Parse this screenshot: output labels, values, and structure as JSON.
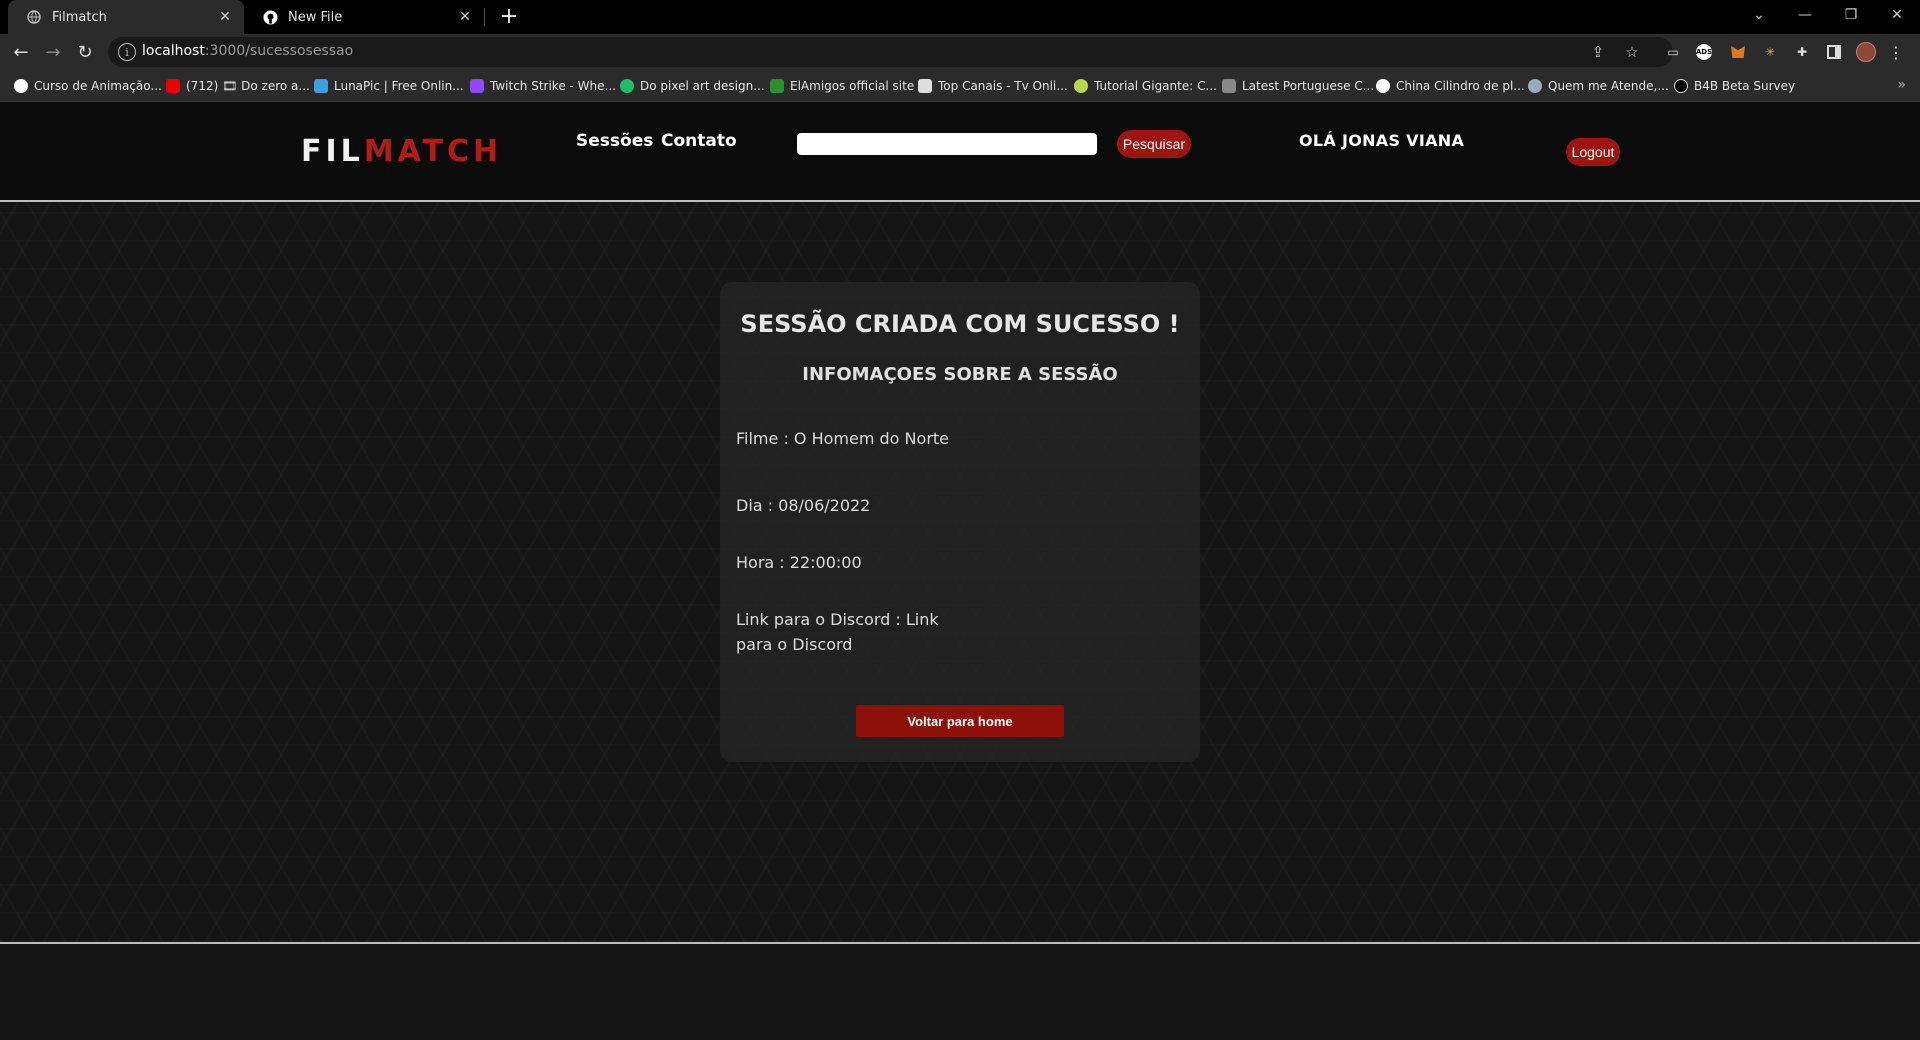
{
  "browser": {
    "tabs": [
      {
        "title": "Filmatch",
        "active": true,
        "icon": "globe-icon"
      },
      {
        "title": "New File",
        "active": false,
        "icon": "github-icon"
      }
    ],
    "url_host": "localhost",
    "url_path": ":3000/sucessosessao",
    "bookmarks": [
      "Curso de Animação...",
      "(712) 🎞 Do zero a...",
      "LunaPic | Free Onlin...",
      "Twitch Strike - Whe...",
      "Do pixel art design...",
      "ElAmigos official site",
      "Top Canais - Tv Onli...",
      "Tutorial Gigante: C...",
      "Latest Portuguese C...",
      "China Cilindro de pl...",
      "Quem me Atende,...",
      "B4B Beta Survey"
    ]
  },
  "header": {
    "logo_part1": "FIL",
    "logo_part2": "MATCH",
    "nav": [
      "Sessões",
      "Contato"
    ],
    "search_button": "Pesquisar",
    "greeting": "OLÁ JONAS VIANA",
    "logout": "Logout"
  },
  "card": {
    "title": "SESSÃO CRIADA COM SUCESSO !",
    "subtitle": "INFOMAÇOES SOBRE A SESSÃO",
    "film": "Filme : O Homem do Norte",
    "day": "Dia : 08/06/2022",
    "time": "Hora : 22:00:00",
    "discord": "Link para o Discord : Link para o Discord",
    "button": "Voltar para home"
  },
  "colors": {
    "brand_red": "#b01c16",
    "button_red": "#8e1109",
    "header_bg": "#0b0b0b"
  }
}
